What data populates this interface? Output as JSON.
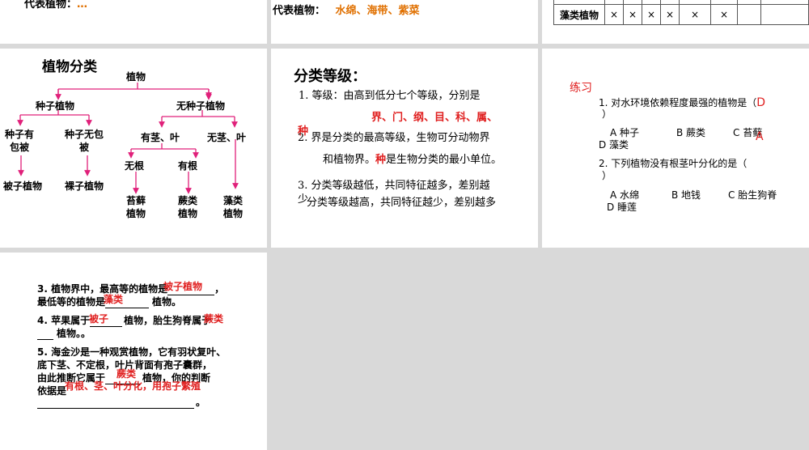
{
  "slide1": {
    "partial_label": "代表植物：",
    "partial_value": "…"
  },
  "slide2": {
    "label": "代表植物：",
    "value": "水绵、海带、紫菜"
  },
  "slide3": {
    "row_label": "藻类植物",
    "marks": [
      "×",
      "×",
      "×",
      "×",
      "×",
      "",
      "×",
      "",
      ""
    ]
  },
  "tree": {
    "title": "植物分类",
    "root": "植物",
    "seed": "种子植物",
    "noseed": "无种子植物",
    "covered_l1": "种子有",
    "covered_l2": "包被",
    "naked_l1": "种子无包",
    "naked_l2": "被",
    "stemleaf": "有茎、叶",
    "nostemleaf": "无茎、叶",
    "noroot": "无根",
    "hasroot": "有根",
    "angio": "被子植物",
    "gymno": "裸子植物",
    "moss_l1": "苔藓",
    "moss_l2": "植物",
    "fern_l1": "蕨类",
    "fern_l2": "植物",
    "algae_l1": "藻类",
    "algae_l2": "植物"
  },
  "levels": {
    "title": "分类等级：",
    "p1": "1. 等级：由高到低分七个等级，分别是",
    "answer1": "界、门、纲、目、科、属、",
    "answer1b": "种",
    "p2a": "2. 界是分类的最高等级，生物可分动物界",
    "p2b_pre": "和植物界。",
    "p2b_red": "种",
    "p2b_post": "是生物分类的最小单位。",
    "p3a": "3. 分类等级越低，共同特征越多，差别越",
    "p3b": "少",
    "p3c": "分类等级越高，共同特征越少，差别越多"
  },
  "practice": {
    "title": "练习",
    "q1": "1. 对水环境依赖程度最强的植物是（",
    "q1_answer": "D",
    "q1_close": "）",
    "q1_opts": [
      "A  种子",
      "B  蕨类",
      "C  苔藓"
    ],
    "q1_optD": "D  藻类",
    "q1_overlay": "A",
    "q2": "2. 下列植物没有根茎叶分化的是（",
    "q2_close": "）",
    "q2_opts": [
      "A  水绵",
      "B  地钱",
      "C  胎生狗脊"
    ],
    "q2_optD": "D  睡莲"
  },
  "fill": {
    "q3_pre": "3. 植物界中，最高等的植物是",
    "q3_ans1": "被子植物",
    "q3_comma": "，",
    "q3_line2_pre": "最低等的植物是",
    "q3_ans2": "藻类",
    "q3_line2_post": "植物。",
    "q4_pre": "4. 苹果属于",
    "q4_ans1": "被子",
    "q4_mid": "植物，胎生狗脊属于",
    "q4_ans2": "蕨类",
    "q4_end": "植物。。",
    "q5_l1": "5. 海金沙是一种观赏植物，它有羽状复叶、",
    "q5_l2": "底下茎、不定根，叶片背面有孢子囊群，",
    "q5_l3_pre": "由此推断它属于",
    "q5_ans1": "蕨类",
    "q5_l3_post": "植物，你的判断",
    "q5_l4": "依据是",
    "q5_ans2": "有根、茎、叶分化，用孢子繁殖",
    "q5_end": "。"
  }
}
